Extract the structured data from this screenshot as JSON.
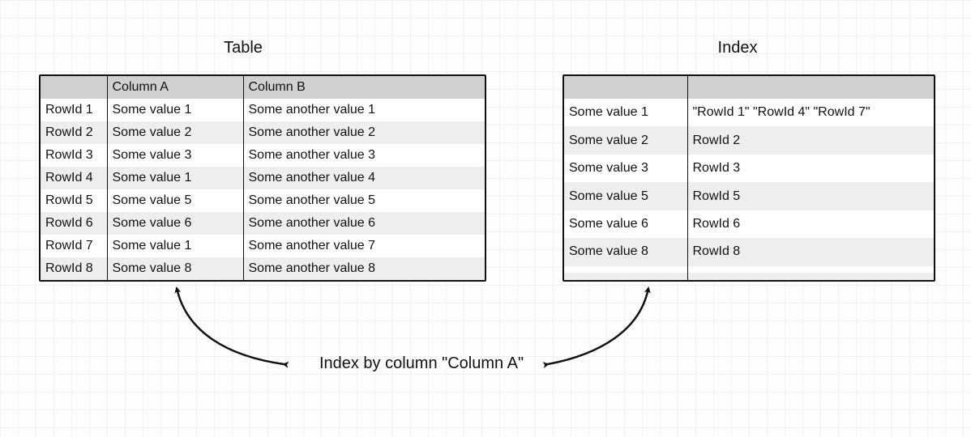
{
  "titles": {
    "left": "Table",
    "right": "Index"
  },
  "left_table": {
    "headers": [
      "",
      "Column A",
      "Column B"
    ],
    "rows": [
      [
        "RowId 1",
        "Some value 1",
        "Some another value 1"
      ],
      [
        "RowId 2",
        "Some value 2",
        "Some another value 2"
      ],
      [
        "RowId 3",
        "Some value 3",
        "Some another value 3"
      ],
      [
        "RowId 4",
        "Some value 1",
        "Some another value 4"
      ],
      [
        "RowId 5",
        "Some value 5",
        "Some another value 5"
      ],
      [
        "RowId 6",
        "Some value 6",
        "Some another value 6"
      ],
      [
        "RowId 7",
        "Some value 1",
        "Some another value 7"
      ],
      [
        "RowId 8",
        "Some value 8",
        "Some another value 8"
      ]
    ]
  },
  "right_table": {
    "headers": [
      "",
      ""
    ],
    "rows": [
      [
        "Some value 1",
        "\"RowId 1\" \"RowId 4\" \"RowId 7\""
      ],
      [
        "Some value 2",
        "RowId 2"
      ],
      [
        "Some value 3",
        "RowId 3"
      ],
      [
        "Some value 5",
        "RowId 5"
      ],
      [
        "Some value 6",
        "RowId 6"
      ],
      [
        "Some value 8",
        "RowId 8"
      ],
      [
        "",
        ""
      ],
      [
        "",
        ""
      ]
    ]
  },
  "caption": "Index by column \"Column A\""
}
